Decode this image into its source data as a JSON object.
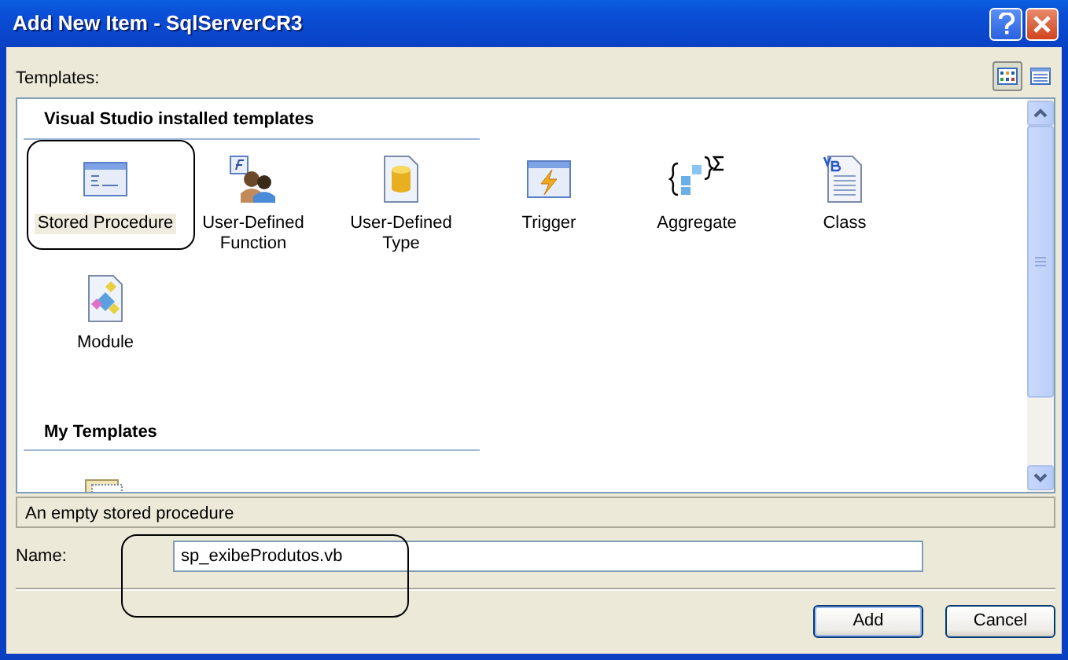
{
  "window": {
    "title": "Add New Item - SqlServerCR3"
  },
  "templates_label": "Templates:",
  "view_buttons": [
    {
      "kind": "large-icons",
      "selected": true
    },
    {
      "kind": "small-icons",
      "selected": false
    }
  ],
  "sections": [
    {
      "heading": "Visual Studio installed templates",
      "items": [
        {
          "label": "Stored Procedure",
          "selected": true
        },
        {
          "label": "User-Defined Function",
          "selected": false
        },
        {
          "label": "User-Defined Type",
          "selected": false
        },
        {
          "label": "Trigger",
          "selected": false
        },
        {
          "label": "Aggregate",
          "selected": false
        },
        {
          "label": "Class",
          "selected": false
        },
        {
          "label": "Module",
          "selected": false
        }
      ]
    },
    {
      "heading": "My Templates"
    }
  ],
  "description": "An empty stored procedure",
  "name_field": {
    "label": "Name:",
    "value": "sp_exibeProdutos.vb"
  },
  "buttons": [
    {
      "label": "Add",
      "default": true
    },
    {
      "label": "Cancel",
      "default": false
    }
  ]
}
